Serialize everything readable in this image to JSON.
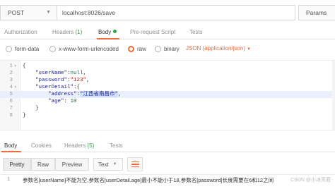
{
  "request": {
    "method": "POST",
    "url": "localhost:8026/save",
    "params_label": "Params"
  },
  "request_tabs": [
    {
      "label": "Authorization",
      "count": ""
    },
    {
      "label": "Headers",
      "count": "(1)"
    },
    {
      "label": "Body",
      "count": ""
    },
    {
      "label": "Pre-request Script",
      "count": ""
    },
    {
      "label": "Tests",
      "count": ""
    }
  ],
  "body_types": {
    "form_data": "form-data",
    "urlencoded": "x-www-form-urlencoded",
    "raw": "raw",
    "binary": "binary",
    "content_type": "JSON (application/json)"
  },
  "editor": {
    "lines": [
      {
        "n": "1",
        "fold": "▾",
        "code": "{"
      },
      {
        "n": "2",
        "fold": "",
        "code": "    \"userName\":null,"
      },
      {
        "n": "3",
        "fold": "",
        "code": "    \"password\":\"123\","
      },
      {
        "n": "4",
        "fold": "▾",
        "code": "    \"userDetail\":{"
      },
      {
        "n": "5",
        "fold": "",
        "code": "        \"address\":\"江西省南昌市\","
      },
      {
        "n": "6",
        "fold": "",
        "code": "        \"age\": 10"
      },
      {
        "n": "7",
        "fold": "",
        "code": "    }"
      },
      {
        "n": "8",
        "fold": "",
        "code": "}"
      }
    ]
  },
  "response_tabs": [
    {
      "label": "Body",
      "count": ""
    },
    {
      "label": "Cookies",
      "count": ""
    },
    {
      "label": "Headers",
      "count": "(5)"
    },
    {
      "label": "Tests",
      "count": ""
    }
  ],
  "response_toolbar": {
    "pretty": "Pretty",
    "raw": "Raw",
    "preview": "Preview",
    "format": "Text"
  },
  "response": {
    "line_number": "1",
    "text": "参数名[userName]不能为空,参数名[userDetail.age]最小不能小于18,参数名[password]长度需要在6和12之间"
  },
  "watermark": "CSDN @小冰亮君",
  "colors": {
    "accent": "#f26b3a",
    "count_green": "#2aa843"
  }
}
